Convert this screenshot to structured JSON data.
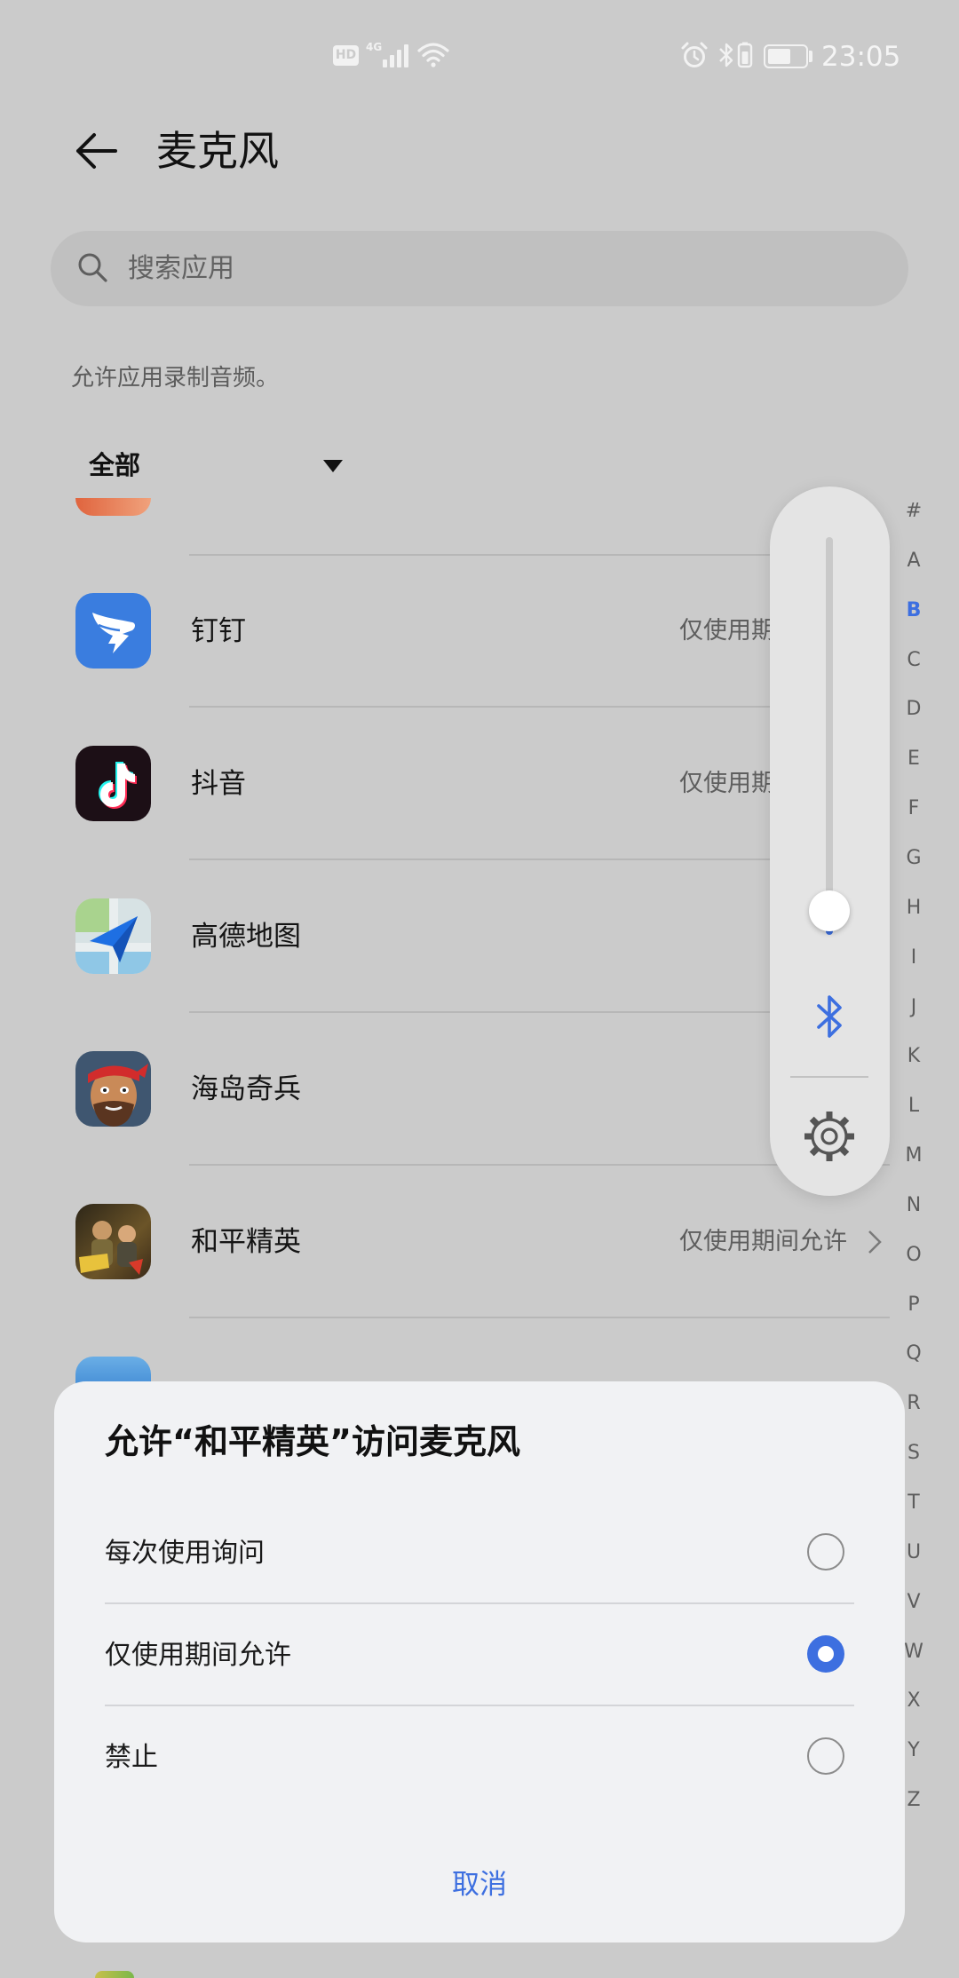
{
  "status_bar": {
    "hd_label": "HD",
    "network_label": "4G",
    "time": "23:05",
    "battery_level": 0.62,
    "icons": [
      "hd-icon",
      "signal-icon",
      "wifi-icon",
      "alarm-icon",
      "bluetooth-icon",
      "vibrate-icon",
      "battery-icon"
    ]
  },
  "header": {
    "title": "麦克风",
    "back_icon": "back-arrow-icon"
  },
  "search": {
    "placeholder": "搜索应用",
    "icon": "search-icon"
  },
  "description": "允许应用录制音频。",
  "filter": {
    "selected": "全部",
    "icon": "dropdown-triangle-icon"
  },
  "apps": [
    {
      "name": "钉钉",
      "status": "仅使用期",
      "icon": "dingtalk-app-icon"
    },
    {
      "name": "抖音",
      "status": "仅使用期",
      "icon": "douyin-app-icon"
    },
    {
      "name": "高德地图",
      "icon": "amap-app-icon"
    },
    {
      "name": "海岛奇兵",
      "icon": "boom-beach-app-icon"
    },
    {
      "name": "和平精英",
      "status": "仅使用期间允许",
      "icon": "peacekeeper-elite-app-icon"
    }
  ],
  "index": {
    "letters": [
      "#",
      "A",
      "B",
      "C",
      "D",
      "E",
      "F",
      "G",
      "H",
      "I",
      "J",
      "K",
      "L",
      "M",
      "N",
      "O",
      "P",
      "Q",
      "R",
      "S",
      "T",
      "U",
      "V",
      "W",
      "X",
      "Y",
      "Z"
    ],
    "active": "B"
  },
  "volume_panel": {
    "level": 0.06,
    "output_icon": "bluetooth-icon",
    "settings_icon": "gear-icon"
  },
  "dialog": {
    "title": "允许“和平精英”访问麦克风",
    "options": [
      {
        "label": "每次使用询问",
        "selected": false
      },
      {
        "label": "仅使用期间允许",
        "selected": true
      },
      {
        "label": "禁止",
        "selected": false
      }
    ],
    "cancel": "取消"
  },
  "colors": {
    "accent": "#3d6fe0",
    "background_dimmed": "#cbcbcb",
    "sheet_background": "#f1f2f4"
  }
}
